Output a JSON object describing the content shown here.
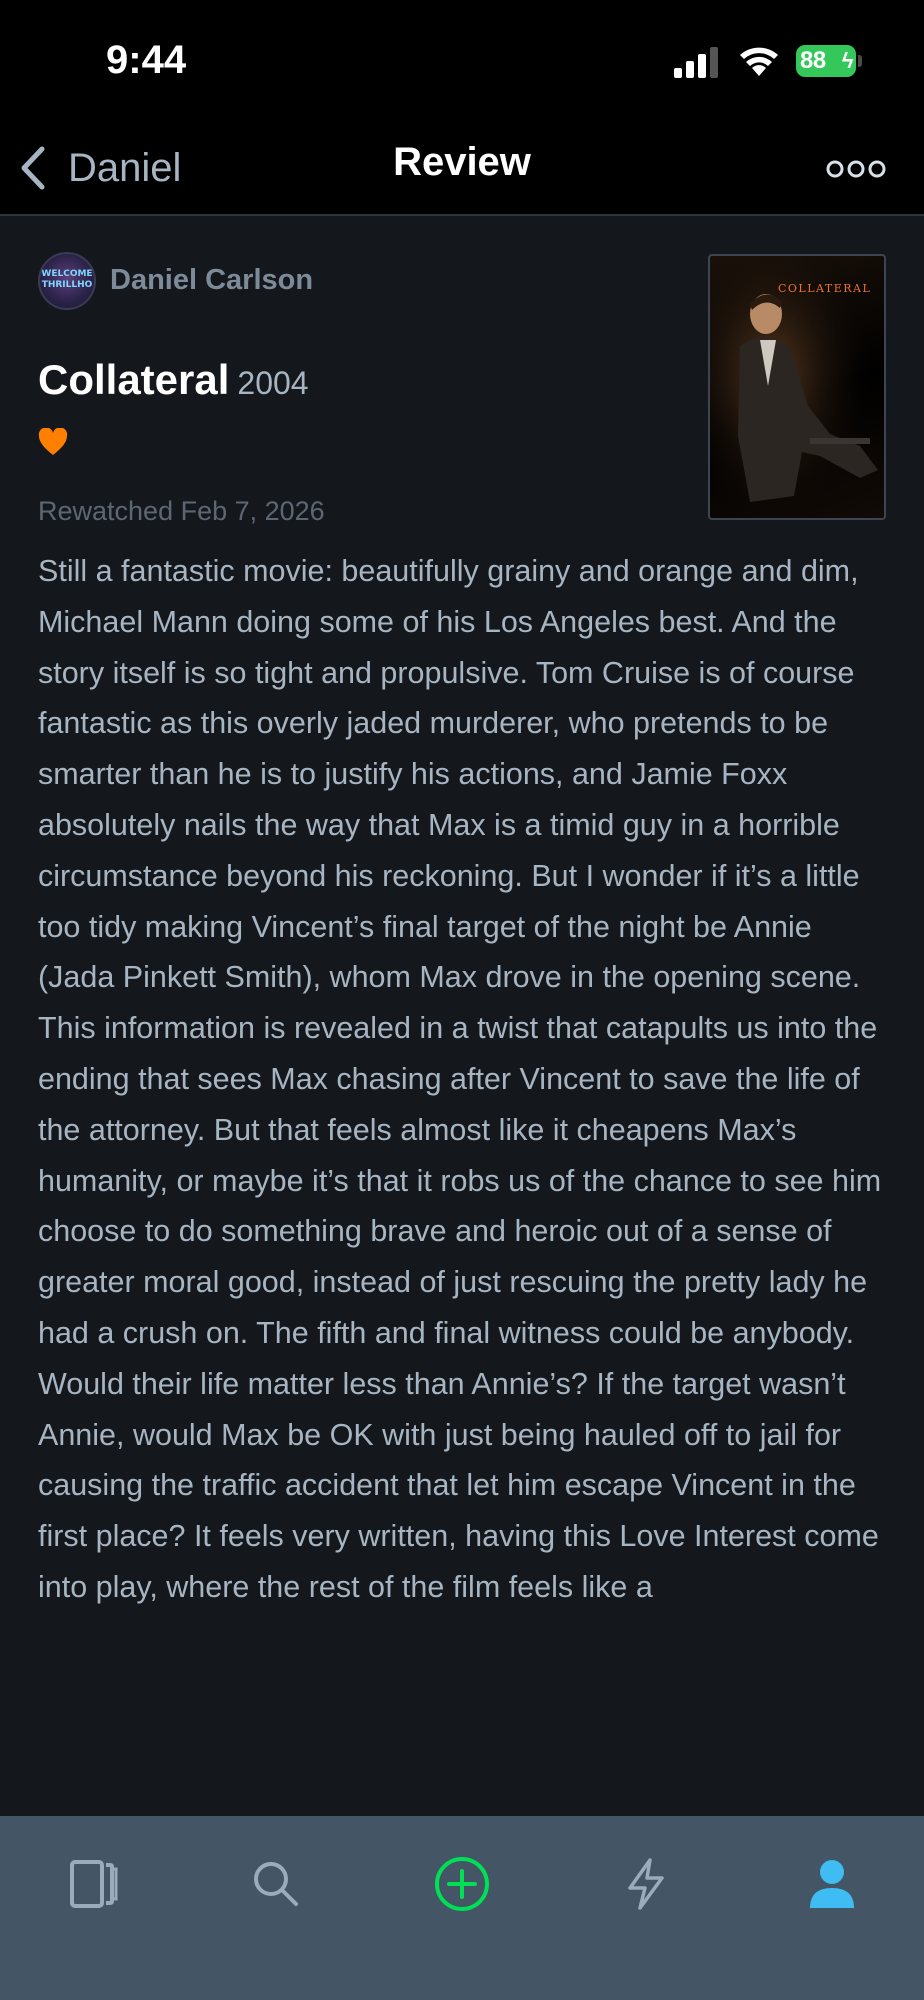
{
  "status_bar": {
    "time": "9:44",
    "battery": "88"
  },
  "nav": {
    "back_label": "Daniel",
    "title": "Review"
  },
  "review": {
    "author": "Daniel Carlson",
    "avatar_text": "WELCOME THRILLHO",
    "film_title": "Collateral",
    "film_year": "2004",
    "liked": true,
    "poster_title": "COLLATERAL",
    "watched_label": "Rewatched Feb 7, 2026",
    "body": "Still a fantastic movie: beautifully grainy and orange and dim, Michael Mann doing some of his Los Angeles best. And the story itself is so tight and propulsive. Tom Cruise is of course fantastic as this overly jaded murderer, who pretends to be smarter than he is to justify his actions, and Jamie Foxx absolutely nails the way that Max is a timid guy in a horrible circumstance beyond his reckoning. But I wonder if it’s a little too tidy making Vincent’s final target of the night be Annie (Jada Pinkett Smith), whom Max drove in the opening scene. This information is revealed in a twist that catapults us into the ending that sees Max chasing after Vincent to save the life of the attorney. But that feels almost like it cheapens Max’s humanity, or maybe it’s that it robs us of the chance to see him choose to do something brave and heroic out of a sense of greater moral good, instead of just rescuing the pretty lady he had a crush on. The fifth and final witness could be anybody. Would their life matter less than Annie’s? If the target wasn’t Annie, would Max be OK with just being hauled off to jail for causing the traffic accident that let him escape Vincent in the first place? It feels very written, having this Love Interest come into play, where the rest of the film feels like a"
  },
  "colors": {
    "background": "#14181c",
    "heart": "#ff8000",
    "add_button": "#00e054",
    "profile_tab": "#40bcf4",
    "tab_bar": "#445566",
    "text_secondary": "#a7b4c2"
  },
  "tabs": [
    {
      "name": "films",
      "icon": "films-icon",
      "active": false
    },
    {
      "name": "search",
      "icon": "search-icon",
      "active": false
    },
    {
      "name": "add",
      "icon": "add-circle-icon",
      "active": false
    },
    {
      "name": "activity",
      "icon": "lightning-icon",
      "active": false
    },
    {
      "name": "profile",
      "icon": "person-icon",
      "active": true
    }
  ]
}
